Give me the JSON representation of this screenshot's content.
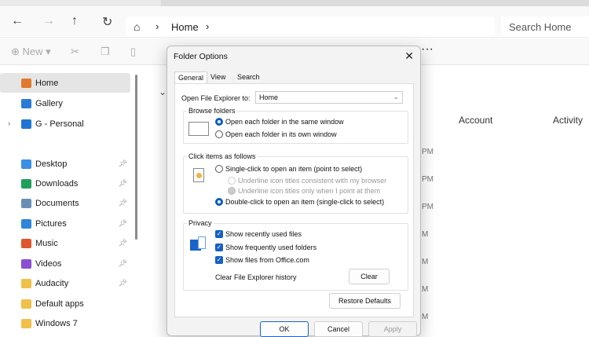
{
  "explorer": {
    "breadcrumb": "Home",
    "search_placeholder": "Search Home",
    "toolbar": {
      "new_label": "New"
    },
    "sidebar": [
      {
        "label": "Home",
        "color": "#e0792e",
        "selected": true
      },
      {
        "label": "Gallery",
        "color": "#2b7bd6"
      },
      {
        "label": "G - Personal",
        "color": "#1f74d4",
        "expandable": true
      },
      {
        "label": "Desktop",
        "color": "#3a8ee6",
        "pinned": true
      },
      {
        "label": "Downloads",
        "color": "#1ea05a",
        "pinned": true
      },
      {
        "label": "Documents",
        "color": "#6a8fb5",
        "pinned": true
      },
      {
        "label": "Pictures",
        "color": "#2c86db",
        "pinned": true
      },
      {
        "label": "Music",
        "color": "#e0542e",
        "pinned": true
      },
      {
        "label": "Videos",
        "color": "#8a4fd1",
        "pinned": true
      },
      {
        "label": "Audacity",
        "color": "#f1c04a",
        "pinned": true
      },
      {
        "label": "Default apps",
        "color": "#f1c04a"
      },
      {
        "label": "Windows 7",
        "color": "#f1c04a"
      }
    ],
    "columns": {
      "account": "Account",
      "activity": "Activity"
    },
    "time_fragments": [
      "PM",
      "PM",
      "PM",
      "M",
      "M",
      "M",
      "M"
    ]
  },
  "dialog": {
    "title": "Folder Options",
    "tabs": [
      "General",
      "View",
      "Search"
    ],
    "open_to_label": "Open File Explorer to:",
    "open_to_value": "Home",
    "browse": {
      "title": "Browse folders",
      "options": [
        "Open each folder in the same window",
        "Open each folder in its own window"
      ]
    },
    "click": {
      "title": "Click items as follows",
      "single": "Single-click to open an item (point to select)",
      "underline1": "Underline icon titles consistent with my browser",
      "underline2": "Underline icon titles only when I point at them",
      "double": "Double-click to open an item (single-click to select)"
    },
    "privacy": {
      "title": "Privacy",
      "checks": [
        "Show recently used files",
        "Show frequently used folders",
        "Show files from Office.com"
      ],
      "clear_label": "Clear File Explorer history",
      "clear_button": "Clear"
    },
    "restore": "Restore Defaults",
    "ok": "OK",
    "cancel": "Cancel",
    "apply": "Apply"
  }
}
